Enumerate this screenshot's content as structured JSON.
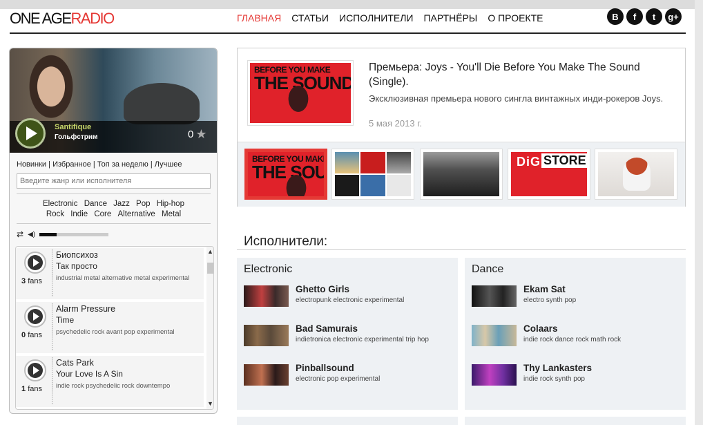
{
  "logo": {
    "part1": "ONE AGE",
    "part2": "RADIO"
  },
  "nav": [
    {
      "label": "ГЛАВНАЯ",
      "active": true
    },
    {
      "label": "СТАТЬИ"
    },
    {
      "label": "ИСПОЛНИТЕЛИ"
    },
    {
      "label": "ПАРТНЁРЫ"
    },
    {
      "label": "О ПРОЕКТЕ"
    }
  ],
  "social": [
    {
      "icon": "vk-icon",
      "glyph": "B"
    },
    {
      "icon": "facebook-icon",
      "glyph": "f"
    },
    {
      "icon": "twitter-icon",
      "glyph": "t"
    },
    {
      "icon": "google-plus-icon",
      "glyph": "g+"
    }
  ],
  "player": {
    "artist": "Santifique",
    "song": "Гольфстрим",
    "rating": "0",
    "tabs": [
      "Новинки",
      "Избранное",
      "Топ за неделю",
      "Лучшее"
    ],
    "search_placeholder": "Введите жанр или исполнителя",
    "genres_row1": [
      "Electronic",
      "Dance",
      "Jazz",
      "Pop",
      "Hip-hop"
    ],
    "genres_row2": [
      "Rock",
      "Indie",
      "Core",
      "Alternative",
      "Metal"
    ],
    "volume": 0.25
  },
  "playlist": [
    {
      "fans_count": "3",
      "fans_label": "fans",
      "artist": "Биопсихоз",
      "song": "Так просто",
      "tags": "industrial metal  alternative metal  experimental"
    },
    {
      "fans_count": "0",
      "fans_label": "fans",
      "artist": "Alarm Pressure",
      "song": "Time",
      "tags": "psychedelic rock  avant pop  experimental"
    },
    {
      "fans_count": "1",
      "fans_label": "fans",
      "artist": "Cats Park",
      "song": "Your Love Is A Sin",
      "tags": "indie rock  psychedelic rock  downtempo"
    }
  ],
  "featured": {
    "title": "Премьера: Joys - You'll Die Before You Make The Sound (Single).",
    "description": "Эксклюзивная премьера нового сингла винтажных инди-рокеров Joys.",
    "date": "5 мая 2013 г.",
    "cover_line1": "BEFORE YOU MAKE",
    "cover_line2": "THE SOUND",
    "thumb4_word1": "DiG",
    "thumb4_word2": "STORE"
  },
  "section_title": "Исполнители:",
  "genres_boxes": [
    {
      "title": "Electronic",
      "artists": [
        {
          "name": "Ghetto Girls",
          "tags": "electropunk  electronic  experimental"
        },
        {
          "name": "Bad Samurais",
          "tags": "indietronica  electronic  experimental  trip hop"
        },
        {
          "name": "Pinballsound",
          "tags": "electronic  pop  experimental"
        }
      ]
    },
    {
      "title": "Dance",
      "artists": [
        {
          "name": "Ekam Sat",
          "tags": "electro  synth pop"
        },
        {
          "name": "Colaars",
          "tags": "indie rock  dance rock  math rock"
        },
        {
          "name": "Thy Lankasters",
          "tags": "indie rock  synth pop"
        }
      ]
    }
  ],
  "colors": {
    "accent": "#e53935",
    "panel": "#eef1f4"
  }
}
